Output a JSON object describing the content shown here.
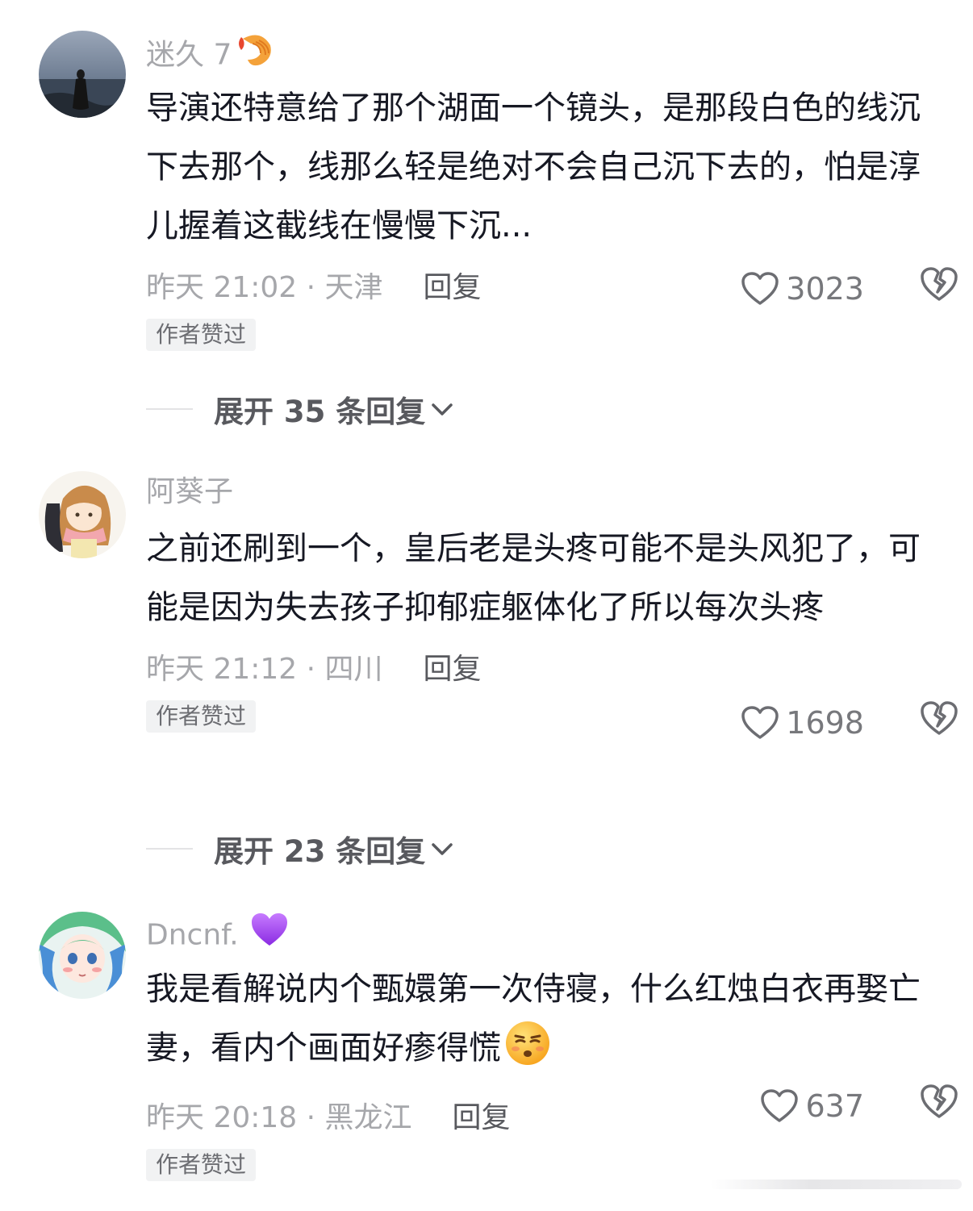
{
  "comments": [
    {
      "username": "迷久 7",
      "username_emoji": "shrimp-emoji",
      "text": "导演还特意给了那个湖面一个镜头，是那段白色的线沉下去那个，线那么轻是绝对不会自己沉下去的，怕是淳儿握着这截线在慢慢下沉...",
      "time_location": "昨天 21:02 · 天津",
      "reply_label": "回复",
      "likes": "3023",
      "badge": "作者赞过",
      "expand_label": "展开 35 条回复"
    },
    {
      "username": "阿葵子",
      "text": "之前还刷到一个，皇后老是头疼可能不是头风犯了，可能是因为失去孩子抑郁症躯体化了所以每次头疼",
      "time_location": "昨天 21:12 · 四川",
      "reply_label": "回复",
      "likes": "1698",
      "badge": "作者赞过",
      "expand_label": "展开 23 条回复"
    },
    {
      "username": "Dncnf.",
      "username_emoji": "purple-heart-emoji",
      "text": "我是看解说内个甄嬛第一次侍寝，什么红烛白衣再娶亡妻，看内个画面好瘆得慌",
      "text_emoji": "unamused-face-emoji",
      "time_location": "昨天 20:18 · 黑龙江",
      "reply_label": "回复",
      "likes": "637",
      "badge": "作者赞过"
    }
  ],
  "colors": {
    "primary_text": "#161823",
    "secondary_text": "#a6a7ab",
    "reply_text": "#58595e",
    "badge_bg": "#f1f2f3",
    "icon_stroke": "#6c6d72"
  }
}
